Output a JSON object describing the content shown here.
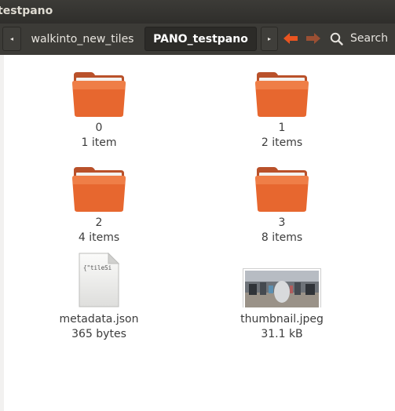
{
  "window": {
    "title": "testpano"
  },
  "toolbar": {
    "breadcrumbs": [
      {
        "label": "walkinto_new_tiles",
        "active": false
      },
      {
        "label": "PANO_testpano",
        "active": true
      }
    ],
    "search_label": "Search",
    "accent": "#e95420"
  },
  "files": [
    {
      "name": "0",
      "meta": "1 item",
      "icon": "folder-icon"
    },
    {
      "name": "1",
      "meta": "2 items",
      "icon": "folder-icon"
    },
    {
      "name": "2",
      "meta": "4 items",
      "icon": "folder-icon"
    },
    {
      "name": "3",
      "meta": "8 items",
      "icon": "folder-icon"
    },
    {
      "name": "metadata.json",
      "meta": "365 bytes",
      "icon": "text-file-icon",
      "preview": "{\"tileSi"
    },
    {
      "name": "thumbnail.jpeg",
      "meta": "31.1 kB",
      "icon": "image-thumbnail-icon"
    }
  ]
}
